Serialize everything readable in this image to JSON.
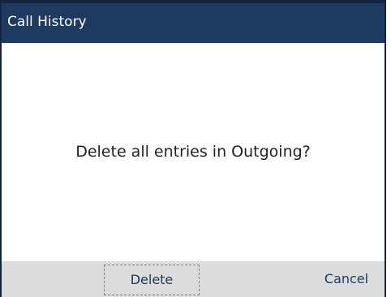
{
  "titlebar": {
    "title": "Call History"
  },
  "dialog": {
    "message": "Delete all entries in Outgoing?"
  },
  "softkeys": {
    "delete_label": "Delete",
    "cancel_label": "Cancel"
  },
  "colors": {
    "titlebar_bg": "#1f3a60",
    "softkey_bar_bg": "#dcdcdc",
    "softkey_text": "#1f3a60"
  }
}
